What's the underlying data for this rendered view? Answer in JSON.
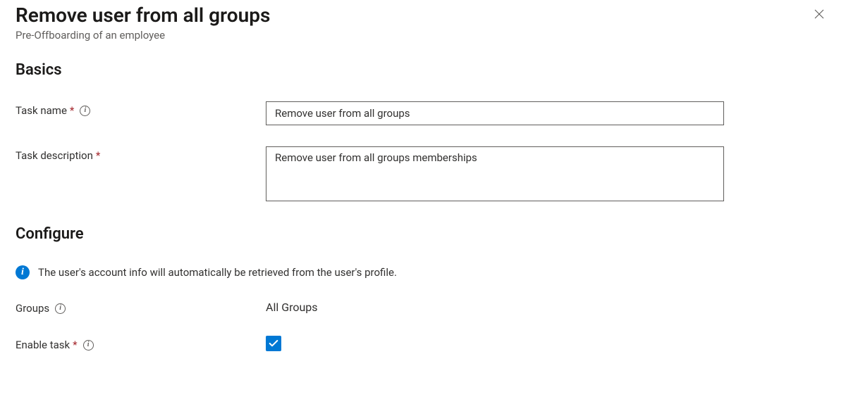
{
  "header": {
    "title": "Remove user from all groups",
    "subtitle": "Pre-Offboarding of an employee"
  },
  "sections": {
    "basics": {
      "heading": "Basics",
      "task_name_label": "Task name",
      "task_name_value": "Remove user from all groups",
      "task_description_label": "Task description",
      "task_description_value": "Remove user from all groups memberships"
    },
    "configure": {
      "heading": "Configure",
      "info_message": "The user's account info will automatically be retrieved from the user's profile.",
      "groups_label": "Groups",
      "groups_value": "All Groups",
      "enable_task_label": "Enable task",
      "enable_task_checked": true
    }
  }
}
